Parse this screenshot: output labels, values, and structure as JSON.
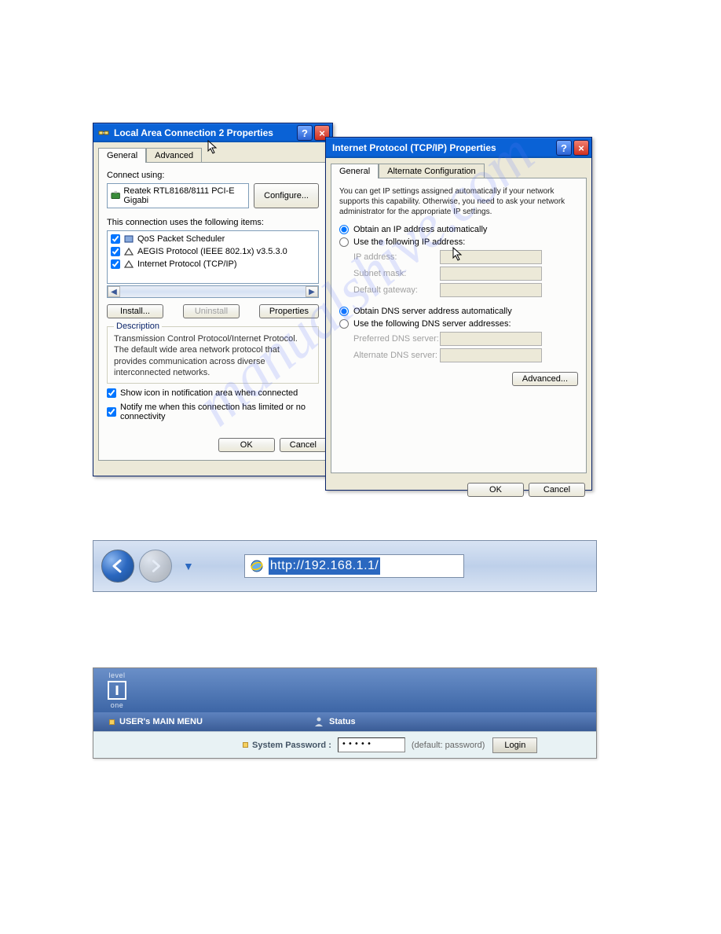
{
  "dialog1": {
    "title": "Local Area Connection 2 Properties",
    "tabs": {
      "general": "General",
      "advanced": "Advanced"
    },
    "connect_using_label": "Connect using:",
    "adapter_name": "Reatek RTL8168/8111 PCI-E Gigabi",
    "configure_button": "Configure...",
    "items_label": "This connection uses the following items:",
    "items": [
      {
        "label": "QoS Packet Scheduler",
        "checked": true
      },
      {
        "label": "AEGIS Protocol (IEEE 802.1x) v3.5.3.0",
        "checked": true
      },
      {
        "label": "Internet Protocol (TCP/IP)",
        "checked": true
      }
    ],
    "install_button": "Install...",
    "uninstall_button": "Uninstall",
    "properties_button": "Properties",
    "description_legend": "Description",
    "description_text": "Transmission Control Protocol/Internet Protocol. The default wide area network protocol that provides communication across diverse interconnected networks.",
    "show_icon_checkbox": "Show icon in notification area when connected",
    "notify_checkbox": "Notify me when this connection has limited or no connectivity",
    "ok_button": "OK",
    "cancel_button": "Cancel"
  },
  "dialog2": {
    "title": "Internet Protocol (TCP/IP) Properties",
    "tabs": {
      "general": "General",
      "alt": "Alternate Configuration"
    },
    "info_text": "You can get IP settings assigned automatically if your network supports this capability. Otherwise, you need to ask your network administrator for the appropriate IP settings.",
    "obtain_ip_auto": "Obtain an IP address automatically",
    "use_following_ip": "Use the following IP address:",
    "ip_address_label": "IP address:",
    "subnet_mask_label": "Subnet mask:",
    "gateway_label": "Default gateway:",
    "obtain_dns_auto": "Obtain DNS server address automatically",
    "use_following_dns": "Use the following DNS server addresses:",
    "preferred_dns_label": "Preferred DNS server:",
    "alternate_dns_label": "Alternate DNS server:",
    "advanced_button": "Advanced...",
    "ok_button": "OK",
    "cancel_button": "Cancel"
  },
  "address_bar": {
    "url": "http://192.168.1.1/"
  },
  "router": {
    "logo_top": "level",
    "logo_bottom": "one",
    "main_menu_label": "USER's MAIN MENU",
    "status_label": "Status",
    "system_password_label": "System Password :",
    "password_value": "•••••",
    "default_hint": "(default: password)",
    "login_button": "Login"
  },
  "watermark": "manualshive.com"
}
